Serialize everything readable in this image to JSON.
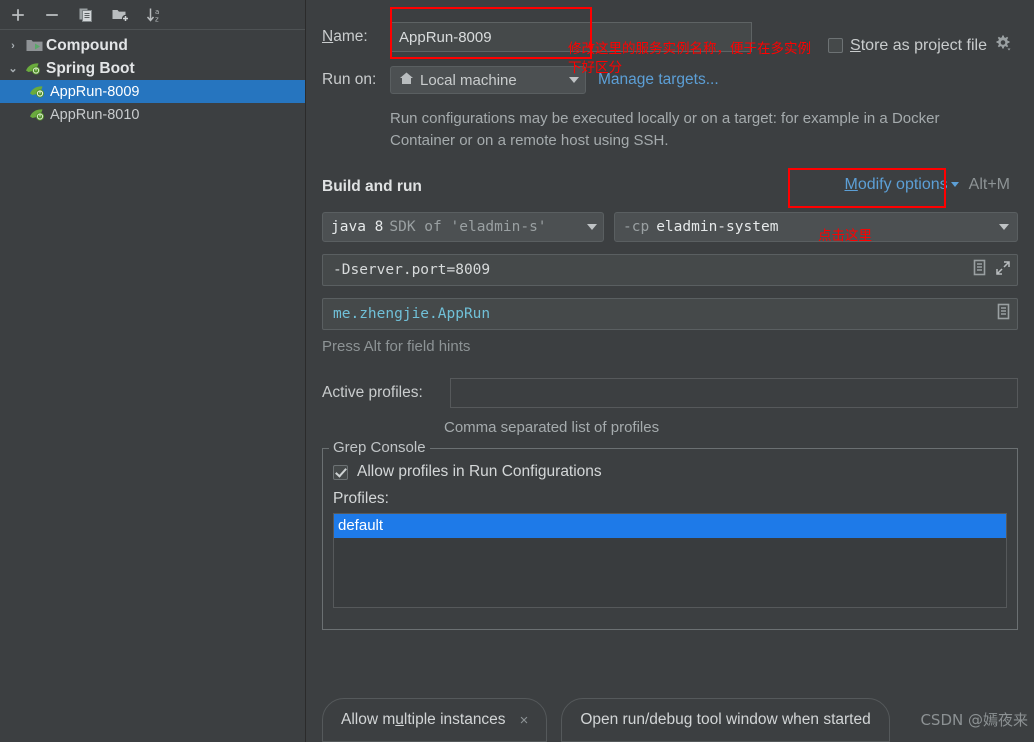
{
  "sidebar": {
    "toolbar": [
      {
        "name": "add-configuration-button",
        "icon": "plus-icon",
        "label": "+"
      },
      {
        "name": "remove-configuration-button",
        "icon": "minus-icon",
        "label": "−"
      },
      {
        "name": "copy-configuration-button",
        "icon": "copy-icon",
        "label": "Copy"
      },
      {
        "name": "new-folder-button",
        "icon": "new-folder-icon",
        "label": "New Folder"
      },
      {
        "name": "sort-configurations-button",
        "icon": "sort-az-icon",
        "label": "Sort"
      }
    ],
    "tree": [
      {
        "label": "Compound",
        "icon": "folder-run-icon",
        "expanded": false,
        "twisty": "›",
        "level": 0,
        "selected": false,
        "bold": true
      },
      {
        "label": "Spring Boot",
        "icon": "spring-leaf-icon",
        "expanded": true,
        "twisty": "⌄",
        "level": 0,
        "selected": false,
        "bold": true
      },
      {
        "label": "AppRun-8009",
        "icon": "spring-leaf-icon",
        "level": 1,
        "selected": true,
        "bold": false
      },
      {
        "label": "AppRun-8010",
        "icon": "spring-leaf-icon",
        "level": 1,
        "selected": false,
        "bold": false
      }
    ]
  },
  "form": {
    "name_label": "Name:",
    "name_label_mnemonic": "N",
    "name_value": "AppRun-8009",
    "store_as_project_file": {
      "label": "Store as project file",
      "mnemonic": "S",
      "checked": false,
      "gear_icon": "gear-icon"
    },
    "run_on_label": "Run on:",
    "run_on_value": "Local machine",
    "run_on_icon": "home-icon",
    "manage_targets_link": "Manage targets...",
    "description": "Run configurations may be executed locally or on a target: for example in a Docker Container or on a remote host using SSH."
  },
  "build_and_run": {
    "section_title": "Build and run",
    "modify_options_label": "Modify options",
    "modify_options_mnemonic": "M",
    "modify_options_shortcut": "Alt+M",
    "sdk_bright": "java 8",
    "sdk_dim": "SDK of 'eladmin-s'",
    "cp_dim": "-cp",
    "cp_bright": "eladmin-system",
    "vm_options_value": "-Dserver.port=8009",
    "main_class_value": "me.zhengjie.AppRun",
    "field_hint": "Press Alt for field hints",
    "expand_icon": "expand-diagonal-icon",
    "list_icon": "document-list-icon"
  },
  "profiles": {
    "active_profiles_label": "Active profiles:",
    "active_profiles_value": "",
    "active_profiles_hint": "Comma separated list of profiles"
  },
  "grep_console": {
    "group_title": "Grep Console",
    "allow_profiles_label": "Allow profiles in Run Configurations",
    "allow_profiles_checked": true,
    "profiles_label": "Profiles:",
    "profile_items": [
      {
        "label": "default",
        "selected": true
      }
    ]
  },
  "bottom_chips": [
    {
      "name": "allow-multiple-instances-chip",
      "text_before": "Allow m",
      "mnemonic": "u",
      "text_after": "ltiple instances",
      "has_close": true,
      "close_glyph": "×"
    },
    {
      "name": "open-run-debug-tool-window-chip",
      "text_before": "Open run/debug tool window when started",
      "mnemonic": "",
      "text_after": "",
      "has_close": false,
      "close_glyph": ""
    }
  ],
  "annotations": [
    {
      "name": "annotation-name-field",
      "text": "修改这里的服务实例名称，便于在多实例\n下好区分",
      "color": "#ff0000"
    },
    {
      "name": "annotation-modify-options",
      "text": "点击这里",
      "color": "#ff0000"
    }
  ],
  "watermark": "CSDN @嫣夜来",
  "colors": {
    "background": "#3c3f41",
    "selection_blue": "#2675bf",
    "list_selection_blue": "#1e7ae8",
    "link_blue": "#5c9fd6",
    "annotation_red": "#ff0000",
    "spring_green": "#6aab3d",
    "value_cyan": "#70c0d8"
  }
}
